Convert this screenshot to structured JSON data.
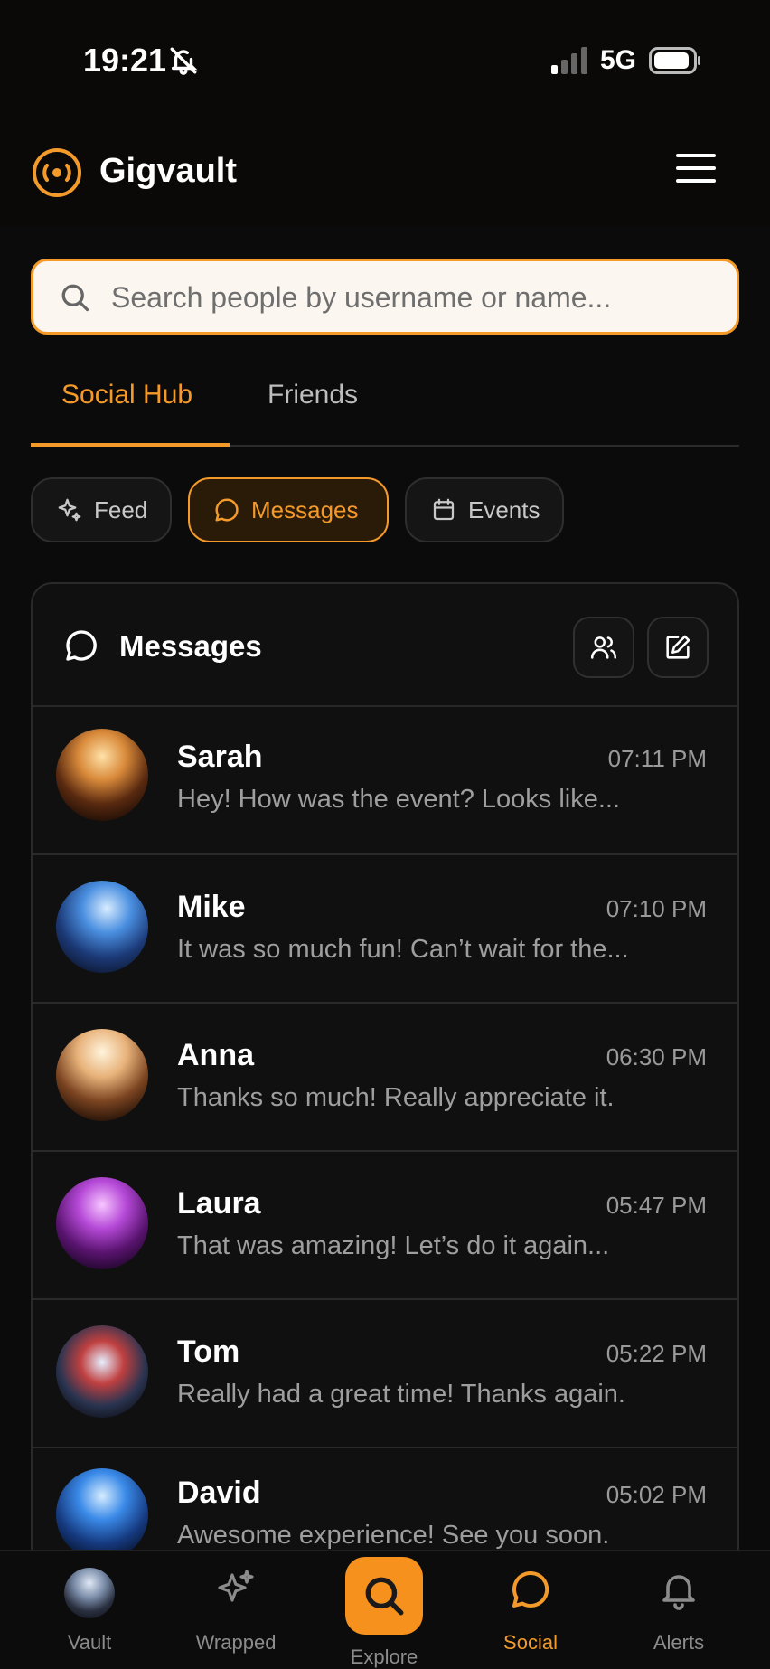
{
  "status_bar": {
    "time": "19:21",
    "network": "5G"
  },
  "header": {
    "app_name": "Gigvault"
  },
  "search": {
    "placeholder": "Search people by username or name..."
  },
  "tabs": [
    {
      "label": "Social Hub",
      "active": true
    },
    {
      "label": "Friends",
      "active": false
    }
  ],
  "chips": [
    {
      "label": "Feed",
      "icon": "sparkle-icon",
      "active": false
    },
    {
      "label": "Messages",
      "icon": "chat-bubble-icon",
      "active": true
    },
    {
      "label": "Events",
      "icon": "calendar-icon",
      "active": false
    }
  ],
  "messages_card": {
    "title": "Messages",
    "actions": [
      "group-icon",
      "compose-icon"
    ],
    "conversations": [
      {
        "name": "Sarah",
        "time": "07:11 PM",
        "preview": "Hey! How was the event? Looks like..."
      },
      {
        "name": "Mike",
        "time": "07:10 PM",
        "preview": "It was so much fun! Can’t wait for the..."
      },
      {
        "name": "Anna",
        "time": "06:30 PM",
        "preview": "Thanks so much! Really appreciate it."
      },
      {
        "name": "Laura",
        "time": "05:47 PM",
        "preview": "That was amazing! Let’s do it again..."
      },
      {
        "name": "Tom",
        "time": "05:22 PM",
        "preview": "Really had a great time! Thanks again."
      },
      {
        "name": "David",
        "time": "05:02 PM",
        "preview": "Awesome experience! See you soon."
      }
    ]
  },
  "bottom_nav": {
    "items": [
      {
        "label": "Vault",
        "icon": "avatar"
      },
      {
        "label": "Wrapped",
        "icon": "sparkle-icon"
      },
      {
        "label": "Explore",
        "icon": "search-icon"
      },
      {
        "label": "Social",
        "icon": "chat-bubble-icon",
        "active": true
      },
      {
        "label": "Alerts",
        "icon": "bell-icon"
      }
    ]
  },
  "colors": {
    "accent": "#f39a2a",
    "background": "#0b0b0b",
    "explore_button": "#f5911c"
  }
}
